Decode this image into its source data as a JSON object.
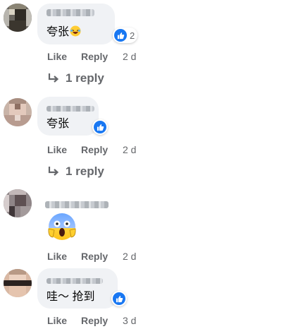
{
  "comments": [
    {
      "name": "",
      "text": "夸张",
      "reaction_count": "2",
      "like_label": "Like",
      "reply_label": "Reply",
      "time": "2 d",
      "replies_label": "1 reply"
    },
    {
      "name": "",
      "text": "夸张",
      "like_label": "Like",
      "reply_label": "Reply",
      "time": "2 d",
      "replies_label": "1 reply"
    },
    {
      "name": "",
      "emoji": "screaming-face-emoji",
      "like_label": "Like",
      "reply_label": "Reply",
      "time": "2 d"
    },
    {
      "name": "",
      "text": "哇～ 抢到",
      "like_label": "Like",
      "reply_label": "Reply",
      "time": "3 d"
    }
  ],
  "colors": {
    "bubble": "#f0f2f5",
    "like_blue": "#1877f2",
    "meta_gray": "#65676b",
    "text": "#050505"
  }
}
